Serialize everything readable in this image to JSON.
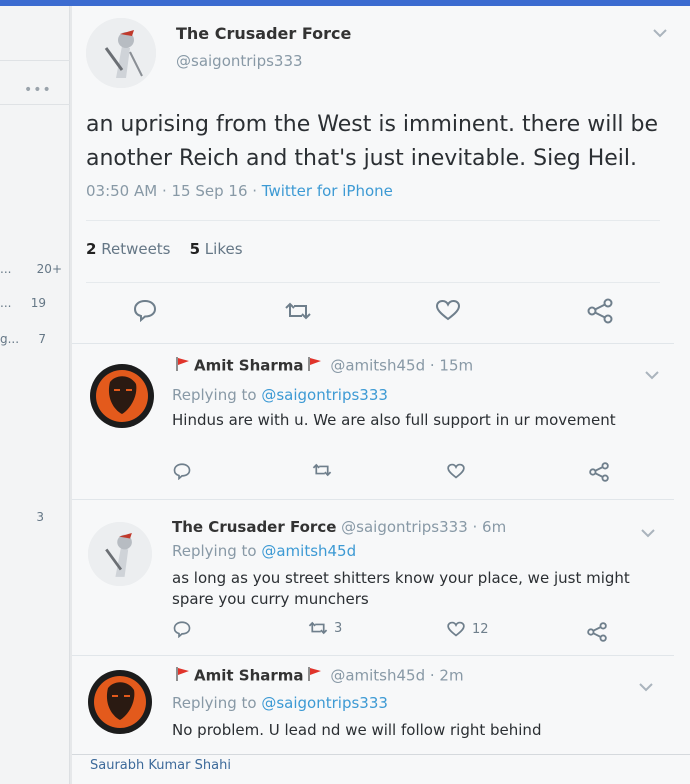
{
  "sidebar": {
    "more_label": "•••",
    "trends": [
      {
        "label": "...",
        "count": "20+"
      },
      {
        "label": "...",
        "count": "19"
      },
      {
        "label": "g...",
        "count": "7"
      },
      {
        "label": "",
        "count": "3"
      }
    ]
  },
  "tweet": {
    "display_name": "The Crusader Force",
    "handle": "@saigontrips333",
    "text": "an uprising from the West is imminent. there will be another Reich and that's just inevitable. Sieg Heil.",
    "time": "03:50 AM · 15 Sep 16 · ",
    "source": "Twitter for iPhone",
    "retweets_count": "2",
    "retweets_label": "Retweets",
    "likes_count": "5",
    "likes_label": "Likes"
  },
  "replies": [
    {
      "display_name": "Amit Sharma",
      "handle": "@amitsh45d · 15m",
      "replying_prefix": "Replying to ",
      "replying_to": "@saigontrips333",
      "text": "Hindus are with u. We are also full support in ur movement",
      "retweet_count": "",
      "like_count": ""
    },
    {
      "display_name": "The Crusader Force",
      "handle": "@saigontrips333 · 6m",
      "replying_prefix": "Replying to ",
      "replying_to": "@amitsh45d",
      "text": "as long as you street shitters know your place, we just might spare you curry munchers",
      "retweet_count": "3",
      "like_count": "12"
    },
    {
      "display_name": "Amit Sharma",
      "handle": "@amitsh45d · 2m",
      "replying_prefix": "Replying to ",
      "replying_to": "@saigontrips333",
      "text": "No problem. U lead nd we will follow right behind"
    }
  ],
  "footer": {
    "author": "Saurabh Kumar Shahi"
  },
  "colors": {
    "link": "#3d9ad4",
    "muted": "#8899a6",
    "flag": "#e0342b",
    "avatar_orange": "#e35a1c"
  }
}
